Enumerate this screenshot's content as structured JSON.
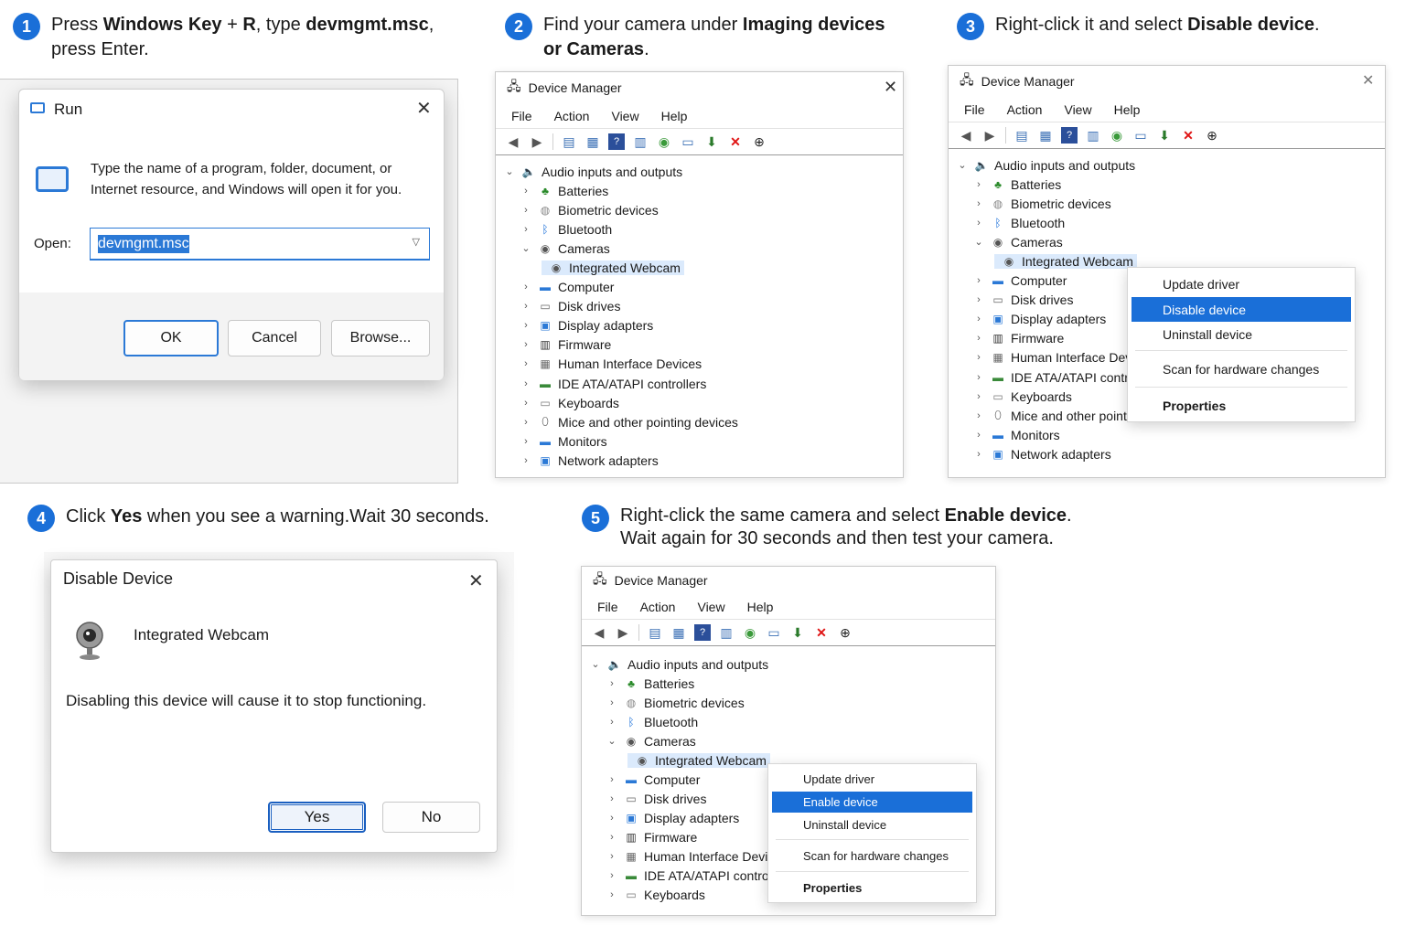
{
  "steps": [
    {
      "num": "1",
      "parts": [
        "Press ",
        "Windows Key",
        " + ",
        "R",
        ", type ",
        "devmgmt.msc",
        ",",
        "press Enter."
      ]
    },
    {
      "num": "2",
      "parts": [
        "Find your camera under ",
        "Imaging devices",
        "or Cameras",
        "."
      ]
    },
    {
      "num": "3",
      "parts": [
        "Right-click it and select ",
        "Disable device",
        "."
      ]
    },
    {
      "num": "4",
      "parts": [
        "Click ",
        "Yes",
        " when you see a warning.Wait 30 seconds."
      ]
    },
    {
      "num": "5",
      "parts": [
        "Right-click the same camera and select ",
        "Enable device",
        ".",
        "Wait again for 30 seconds and then test your camera."
      ]
    }
  ],
  "run_dialog": {
    "title": "Run",
    "description": "Type the name of a program, folder, document, or Internet resource, and Windows will open it for you.",
    "description_line1": "Type the name of a program, folder, document, or",
    "description_line2": "Internet resource, and Windows will open it for you.",
    "open_label": "Open:",
    "open_value": "devmgmt.msc",
    "ok": "OK",
    "cancel": "Cancel",
    "browse": "Browse..."
  },
  "device_manager": {
    "title": "Device Manager",
    "menu": [
      "File",
      "Action",
      "View",
      "Help"
    ],
    "tree_full": [
      "Audio inputs and outputs",
      "Batteries",
      "Biometric devices",
      "Bluetooth",
      "Cameras",
      "Integrated Webcam",
      "Computer",
      "Disk drives",
      "Display adapters",
      "Firmware",
      "Human Interface Devices",
      "IDE ATA/ATAPI controllers",
      "Keyboards",
      "Mice and other pointing devices",
      "Monitors",
      "Network adapters"
    ],
    "tree_3": [
      "Audio inputs and outputs",
      "Batteries",
      "Biometric devices",
      "Bluetooth",
      "Cameras",
      "Integrated Webcam",
      "Computer",
      "Disk drives",
      "Display adapters",
      "Firmware",
      "Human Interface Dev",
      "IDE ATA/ATAPI contro",
      "Keyboards",
      "Mice and other point",
      "Monitors",
      "Network adapters"
    ],
    "tree_5": [
      "Audio inputs and outputs",
      "Batteries",
      "Biometric devices",
      "Bluetooth",
      "Cameras",
      "Integrated Webcam",
      "Computer",
      "Disk drives",
      "Display adapters",
      "Firmware",
      "Human Interface Devic",
      "IDE ATA/ATAPI control",
      "Keyboards"
    ]
  },
  "context_menu_disable": {
    "update": "Update driver",
    "toggle": "Disable device",
    "uninstall": "Uninstall device",
    "scan": "Scan for hardware changes",
    "properties": "Properties"
  },
  "context_menu_enable": {
    "update": "Update driver",
    "toggle": "Enable device",
    "uninstall": "Uninstall device",
    "scan": "Scan for hardware changes",
    "properties": "Properties"
  },
  "disable_dialog": {
    "title": "Disable Device",
    "device": "Integrated Webcam",
    "warning": "Disabling this device will cause it to stop functioning.",
    "yes": "Yes",
    "no": "No"
  },
  "colors": {
    "accent": "#1a6fd8",
    "selection": "#dbeafc"
  }
}
